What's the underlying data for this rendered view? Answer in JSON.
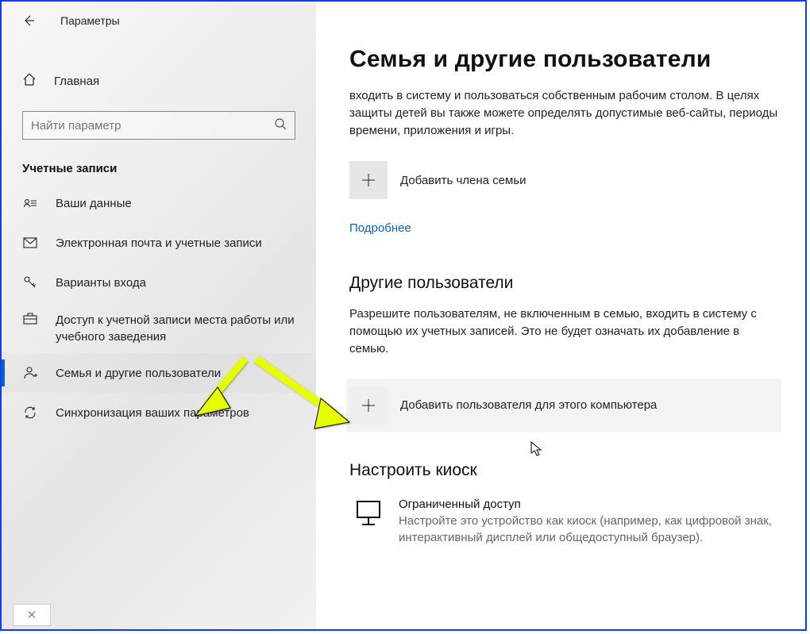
{
  "header": {
    "app_title": "Параметры"
  },
  "sidebar": {
    "home_label": "Главная",
    "search_placeholder": "Найти параметр",
    "section_label": "Учетные записи",
    "items": [
      {
        "label": "Ваши данные"
      },
      {
        "label": "Электронная почта и учетные записи"
      },
      {
        "label": "Варианты входа"
      },
      {
        "label": "Доступ к учетной записи места работы или учебного заведения"
      },
      {
        "label": "Семья и другие пользователи"
      },
      {
        "label": "Синхронизация ваших параметров"
      }
    ]
  },
  "main": {
    "title": "Семья и другие пользователи",
    "intro": "входить в систему и пользоваться собственным рабочим столом. В целях защиты детей вы также можете определять допустимые веб-сайты, периоды времени, приложения и игры.",
    "add_family_label": "Добавить члена семьи",
    "learn_more": "Подробнее",
    "other_users_header": "Другие пользователи",
    "other_users_text": "Разрешите пользователям, не включенным в семью, входить в систему с помощью их учетных записей. Это не будет означать их добавление в семью.",
    "add_other_label": "Добавить пользователя для этого компьютера",
    "kiosk_header": "Настроить киоск",
    "kiosk_title": "Ограниченный доступ",
    "kiosk_desc": "Настройте это устройство как киоск (например, как цифровой знак, интерактивный дисплей или общедоступный браузер)."
  }
}
